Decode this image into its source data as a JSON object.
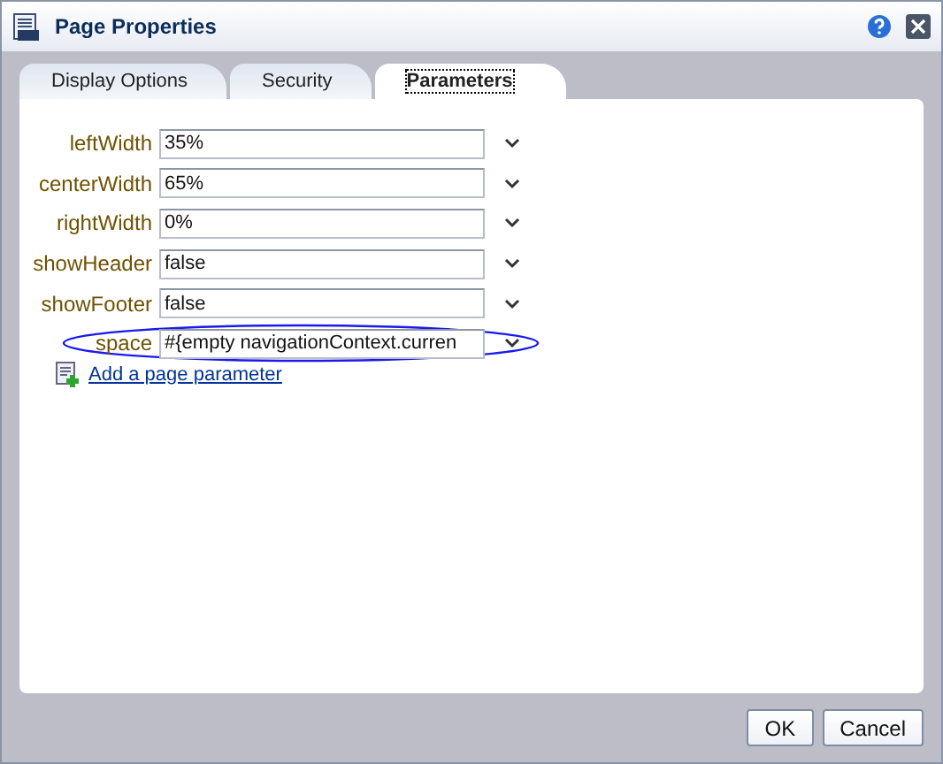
{
  "window": {
    "title": "Page Properties"
  },
  "tabs": [
    {
      "label": "Display Options",
      "selected": false
    },
    {
      "label": "Security",
      "selected": false
    },
    {
      "label": "Parameters",
      "selected": true
    }
  ],
  "parameters": [
    {
      "name": "leftWidth",
      "value": "35%",
      "highlighted": false
    },
    {
      "name": "centerWidth",
      "value": "65%",
      "highlighted": false
    },
    {
      "name": "rightWidth",
      "value": "0%",
      "highlighted": false
    },
    {
      "name": "showHeader",
      "value": "false",
      "highlighted": false
    },
    {
      "name": "showFooter",
      "value": "false",
      "highlighted": false
    },
    {
      "name": "space",
      "value": "#{empty navigationContext.curren",
      "highlighted": true
    }
  ],
  "add_link": "Add a page parameter",
  "buttons": [
    "OK",
    "Cancel"
  ]
}
